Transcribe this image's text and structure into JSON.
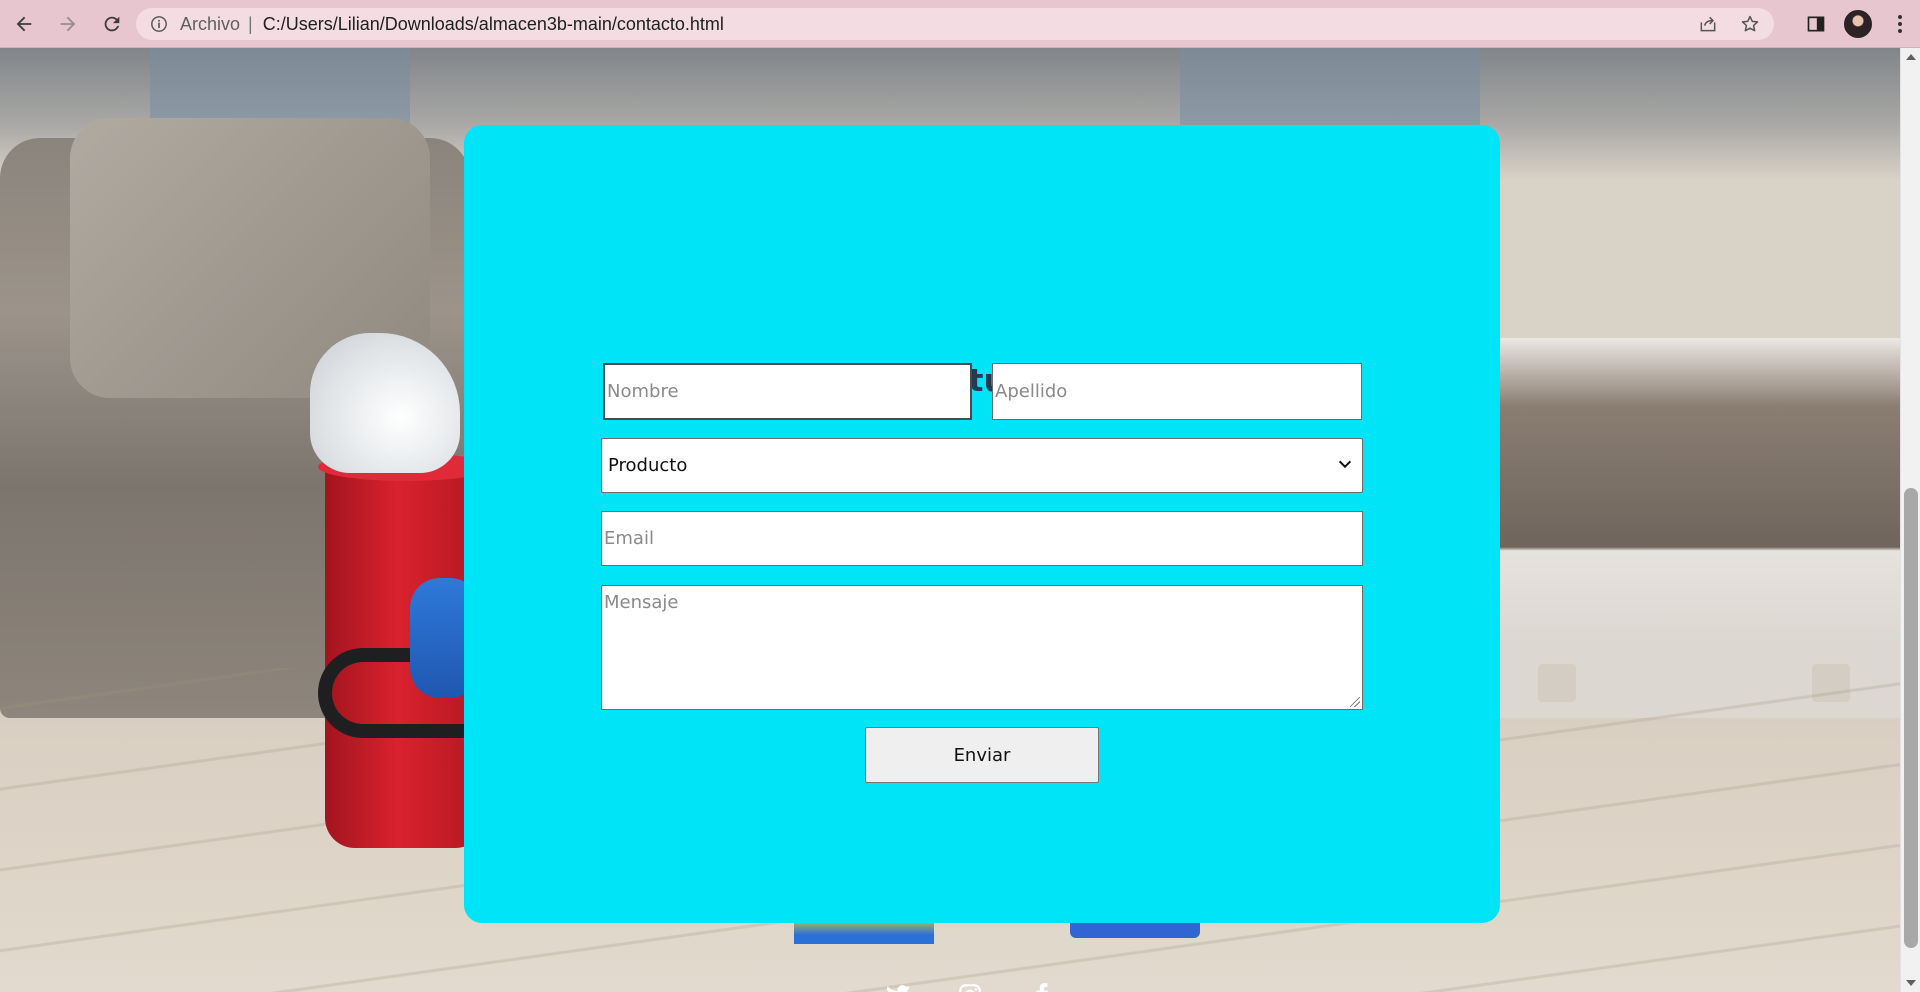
{
  "browser": {
    "scheme_label": "Archivo",
    "separator": "|",
    "url": "C:/Users/Lilian/Downloads/almacen3b-main/contacto.html",
    "chrome_color": "#e8c6cf"
  },
  "form": {
    "title": "Envianos tu mensaje",
    "first_name_placeholder": "Nombre",
    "last_name_placeholder": "Apellido",
    "product_selected": "Producto",
    "email_placeholder": "Email",
    "message_placeholder": "Mensaje",
    "submit_label": "Enviar",
    "card_color": "#00e4f8",
    "title_color": "#233b52"
  },
  "footer": {
    "social": [
      {
        "icon": "twitter-icon"
      },
      {
        "icon": "instagram-icon"
      },
      {
        "icon": "facebook-icon"
      }
    ]
  }
}
